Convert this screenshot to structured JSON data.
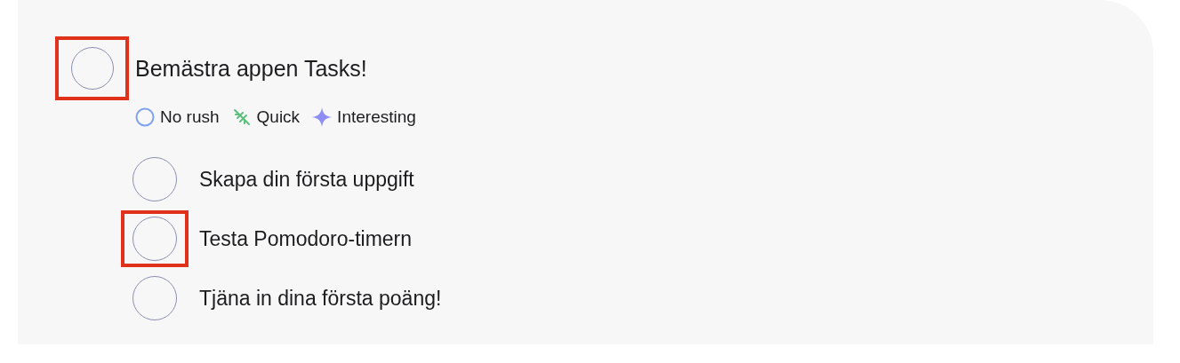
{
  "task": {
    "title": "Bemästra appen Tasks!",
    "checked": false,
    "highlighted": true,
    "tags": [
      {
        "kind": "priority",
        "label": "No rush",
        "color": "#7fa2f0"
      },
      {
        "kind": "effort",
        "label": "Quick",
        "color": "#5cbf7d"
      },
      {
        "kind": "interest",
        "label": "Interesting",
        "color": "#8e8cf5"
      }
    ],
    "subtasks": [
      {
        "title": "Skapa din första uppgift",
        "checked": false,
        "highlighted": false
      },
      {
        "title": "Testa Pomodoro-timern",
        "checked": false,
        "highlighted": true
      },
      {
        "title": "Tjäna in dina första poäng!",
        "checked": false,
        "highlighted": false
      }
    ]
  }
}
